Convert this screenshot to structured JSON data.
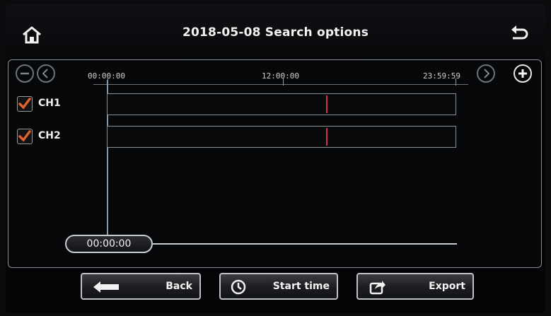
{
  "header": {
    "title": "2018-05-08  Search options",
    "home_icon": "home-icon",
    "back_icon": "return-arrow-icon"
  },
  "timeline": {
    "zoom_out_icon": "minus-circle-icon",
    "prev_icon": "chevron-left-circle-icon",
    "next_icon": "chevron-right-circle-icon",
    "zoom_in_icon": "plus-circle-icon",
    "ruler": [
      "00:00:00",
      "12:00:00",
      "23:59:59"
    ]
  },
  "channels": [
    {
      "label": "CH1",
      "checked": true,
      "record_mark_fraction": 0.63
    },
    {
      "label": "CH2",
      "checked": true,
      "record_mark_fraction": 0.63
    }
  ],
  "playback": {
    "current_time": "00:00:00",
    "position_fraction": 0.0
  },
  "buttons": {
    "back": "Back",
    "start_time": "Start time",
    "export": "Export"
  },
  "colors": {
    "check": "#e0622a",
    "record_mark": "#d0305a"
  }
}
